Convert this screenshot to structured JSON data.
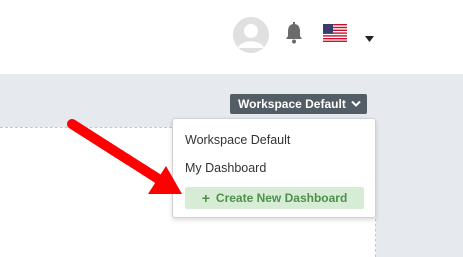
{
  "header": {
    "avatar_icon": "user-avatar-icon",
    "notification_icon": "bell-icon",
    "language_flag": "us-flag-icon",
    "language_caret_icon": "caret-down-icon"
  },
  "workspace": {
    "button_label": "Workspace Default",
    "chevron_icon": "chevron-down-icon"
  },
  "dropdown": {
    "items": [
      {
        "label": "Workspace Default"
      },
      {
        "label": "My Dashboard"
      }
    ],
    "create_button": {
      "icon": "plus-icon",
      "icon_glyph": "+",
      "label": "Create New Dashboard"
    }
  },
  "annotation": {
    "arrow_icon": "red-arrow-icon",
    "color": "#ff0000"
  },
  "colors": {
    "header_bg": "#ffffff",
    "page_bg": "#e6e9ed",
    "workspace_button_bg": "#525d66",
    "create_button_bg": "#d6ecd5",
    "create_button_text": "#4e8f4a"
  }
}
